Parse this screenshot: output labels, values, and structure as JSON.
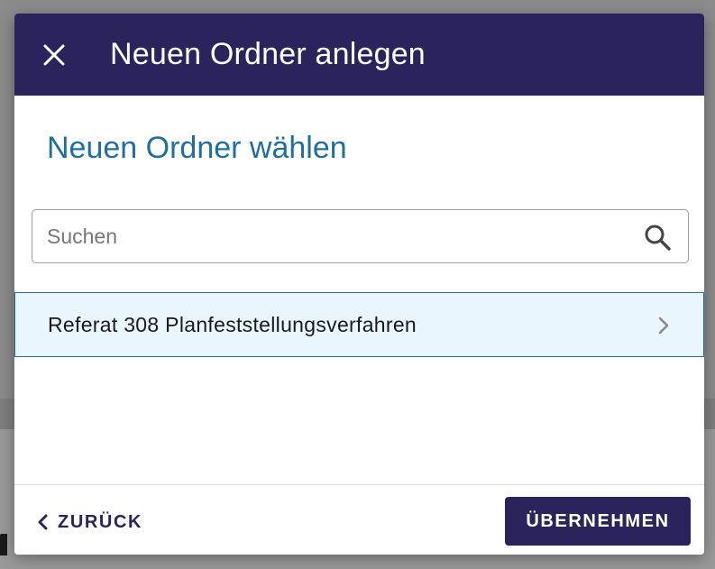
{
  "dialog": {
    "title": "Neuen Ordner anlegen",
    "close_icon": "close-icon"
  },
  "section": {
    "title": "Neuen Ordner wählen"
  },
  "search": {
    "placeholder": "Suchen",
    "value": "",
    "icon": "search-icon"
  },
  "folders": [
    {
      "label": "Referat 308 Planfeststellungsverfahren",
      "icon": "chevron-right-icon"
    }
  ],
  "footer": {
    "back_label": "ZURÜCK",
    "back_icon": "chevron-left-icon",
    "apply_label": "ÜBERNEHMEN"
  },
  "colors": {
    "header_bg": "#2b245c",
    "accent_blue": "#1f6f9e",
    "selected_row_bg": "#eaf6fd",
    "primary_button": "#2b245c"
  }
}
